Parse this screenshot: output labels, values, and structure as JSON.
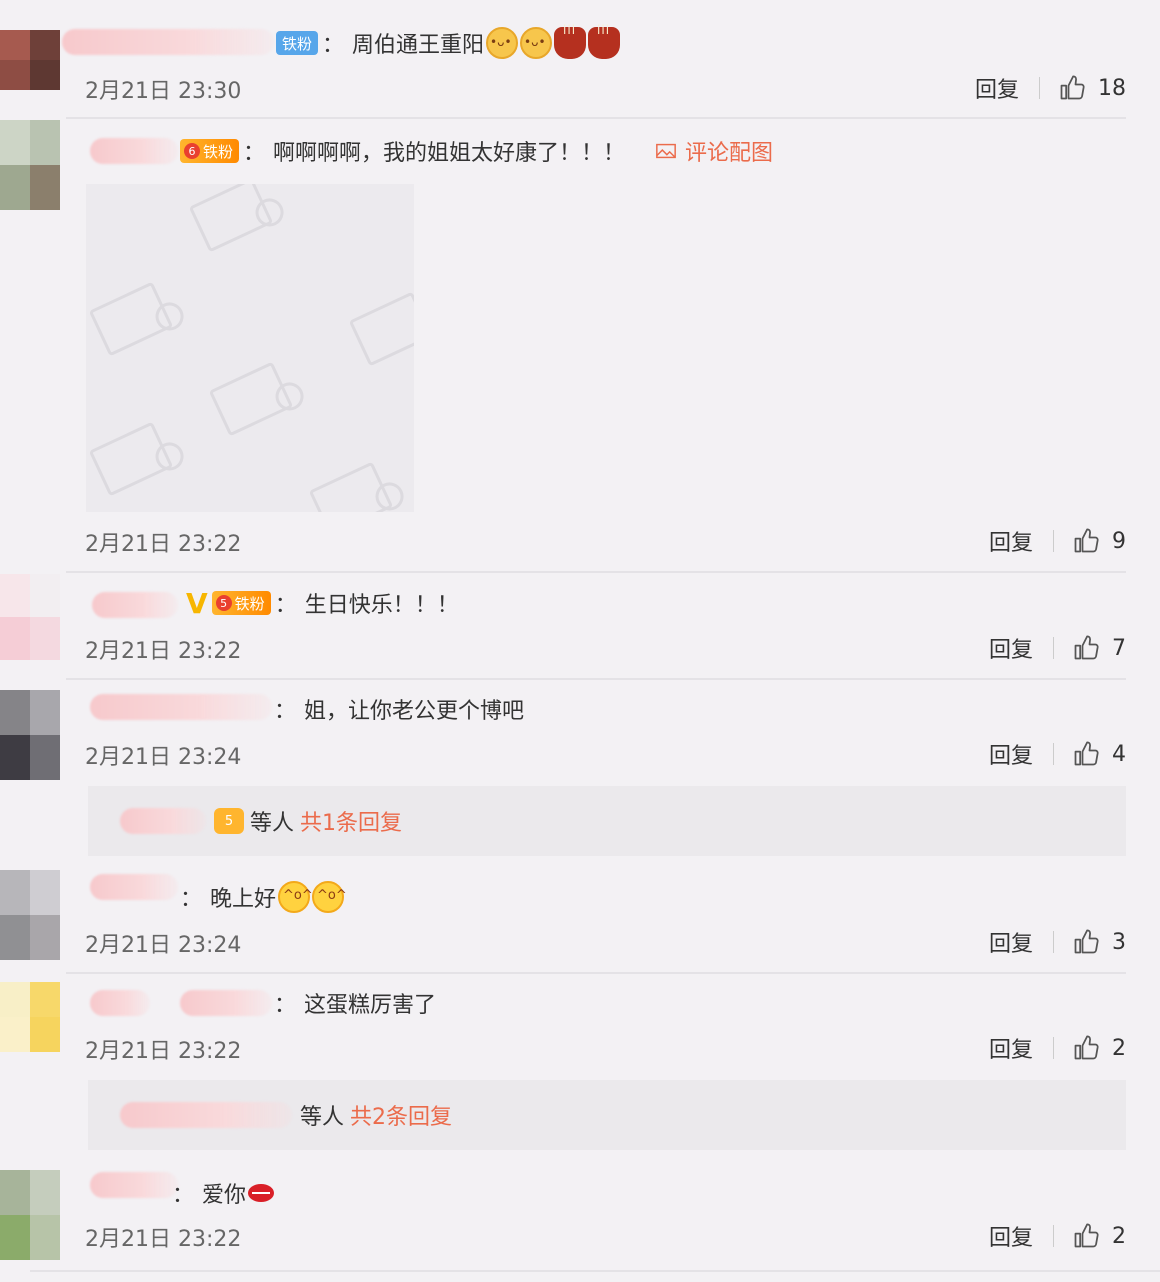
{
  "comments": [
    {
      "text": "周伯通王重阳",
      "badge": "铁粉",
      "time": "2月21日 23:30",
      "reply_label": "回复",
      "likes": "18"
    },
    {
      "text": "啊啊啊啊，我的姐姐太好康了！！！",
      "badge": "铁粉",
      "badge_level": "6",
      "pic_link": "评论配图",
      "time": "2月21日 23:22",
      "reply_label": "回复",
      "likes": "9"
    },
    {
      "text": "生日快乐！！！",
      "badge": "铁粉",
      "badge_level": "5",
      "time": "2月21日 23:22",
      "reply_label": "回复",
      "likes": "7"
    },
    {
      "text": "姐，让你老公更个博吧",
      "time": "2月21日 23:24",
      "reply_label": "回复",
      "likes": "4",
      "sub_reply": {
        "others": "等人",
        "count": "共1条回复",
        "badge_level": "5"
      }
    },
    {
      "text": "晚上好",
      "time": "2月21日 23:24",
      "reply_label": "回复",
      "likes": "3"
    },
    {
      "text": "这蛋糕厉害了",
      "time": "2月21日 23:22",
      "reply_label": "回复",
      "likes": "2",
      "sub_reply": {
        "others": "等人",
        "count": "共2条回复"
      }
    },
    {
      "text": "爱你",
      "time": "2月21日 23:22",
      "reply_label": "回复",
      "likes": "2"
    }
  ],
  "colon": "：",
  "colors": {
    "link": "#eb6b4b",
    "badge_blue": "#57a6ea",
    "badge_gold": "#ff9f1a",
    "v_mark": "#f7b600"
  },
  "icons": [
    "thumbs-up-icon",
    "image-icon",
    "crown-icon"
  ]
}
